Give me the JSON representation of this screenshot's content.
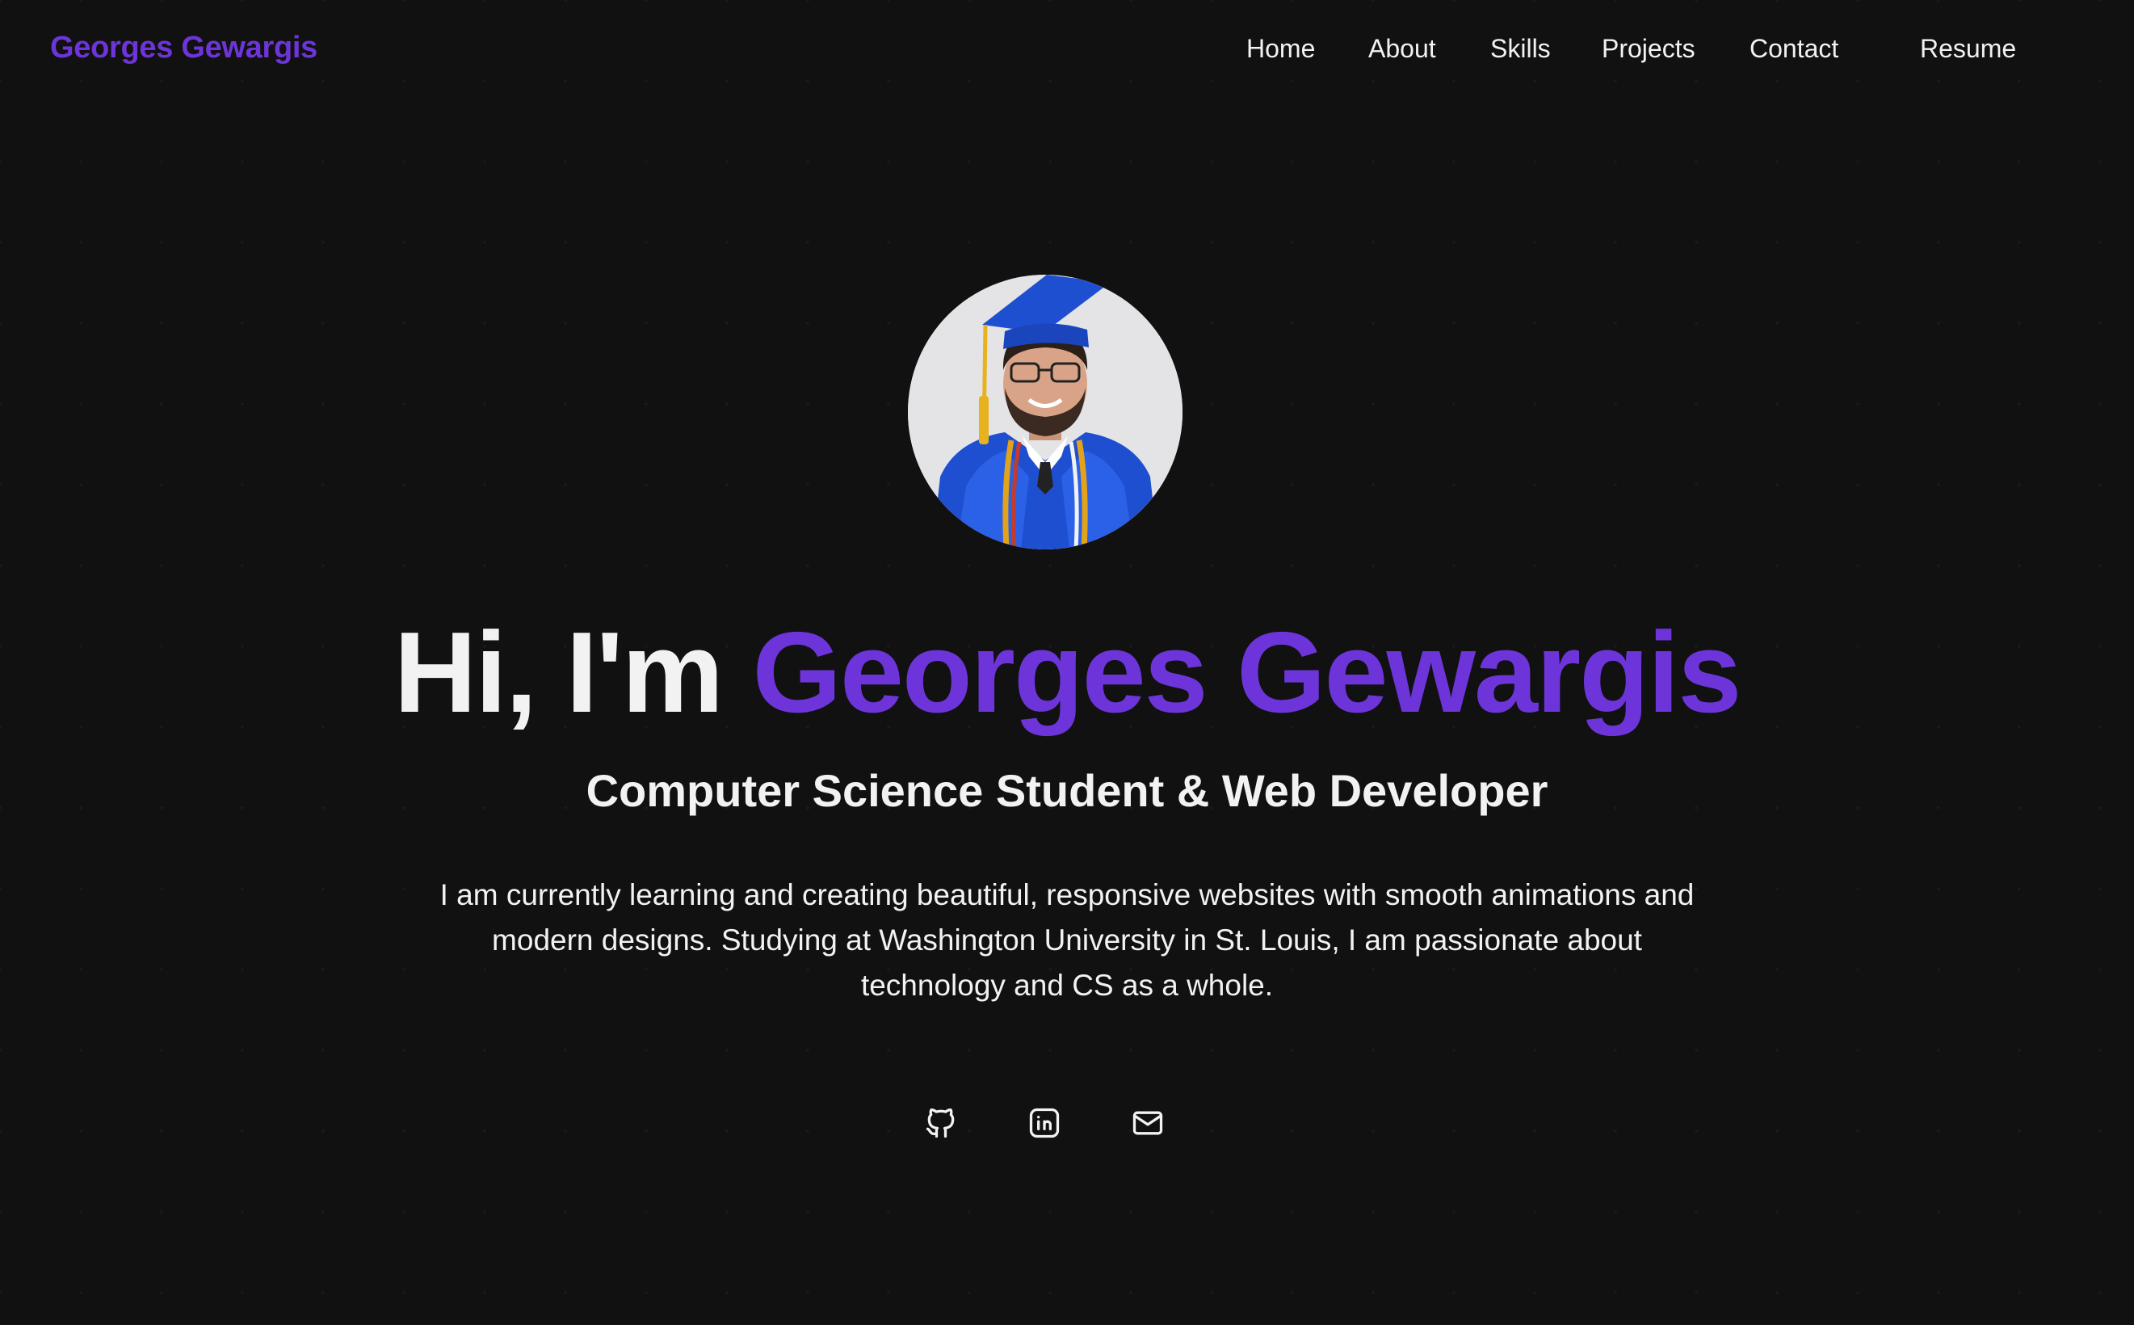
{
  "nav": {
    "brand": "Georges Gewargis",
    "links": [
      {
        "label": "Home"
      },
      {
        "label": "About"
      },
      {
        "label": "Skills"
      },
      {
        "label": "Projects"
      },
      {
        "label": "Contact"
      },
      {
        "label": "Resume"
      }
    ]
  },
  "hero": {
    "avatar_alt": "Georges Gewargis in graduation cap and gown",
    "greeting": "Hi, I'm ",
    "name": "Georges Gewargis",
    "subtitle": "Computer Science Student & Web Developer",
    "bio": "I am currently learning and creating beautiful, responsive websites with smooth animations and modern designs. Studying at Washington University in St. Louis, I am passionate about technology and CS as a whole.",
    "socials": [
      {
        "icon": "github-icon"
      },
      {
        "icon": "linkedin-icon"
      },
      {
        "icon": "mail-icon"
      }
    ]
  },
  "theme": {
    "background": "#111111",
    "accent": "#6d35d9",
    "text": "#f2f2f2"
  }
}
